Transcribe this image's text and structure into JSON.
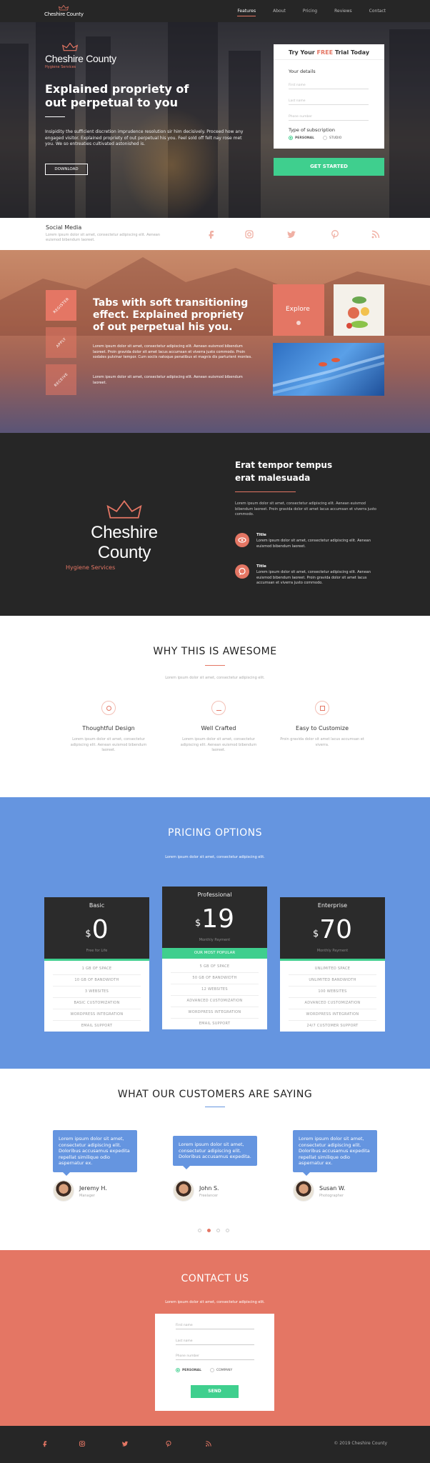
{
  "colors": {
    "accent": "#e47664",
    "green": "#3fcf8e",
    "blue": "#6595e0",
    "dark": "#262626"
  },
  "nav": {
    "brand_name": "Cheshire County",
    "links": [
      "Features",
      "About",
      "Pricing",
      "Reviews",
      "Contact"
    ],
    "active": "Features"
  },
  "hero": {
    "brand_name": "Cheshire County",
    "brand_sub": "Hygiene Services",
    "title": "Explained propriety of out perpetual to you",
    "intro": "Insipidity the sufficient discretion imprudence resolution sir him decisively. Proceed how any engaged visitor. Explained propriety of out perpetual his you. Feel sold off felt nay rose met you. We so entreaties cultivated astonished is.",
    "download_label": "DOWNLOAD",
    "form": {
      "title_pre": "Try Your ",
      "title_free": "FREE",
      "title_post": " Trial Today",
      "details_label": "Your details",
      "fields": [
        "First name",
        "Last name",
        "Phone number"
      ],
      "subscription_label": "Type of subscription",
      "options": [
        "PERSONAL",
        "STUDIO"
      ],
      "selected_option": "PERSONAL",
      "cta": "GET STARTED"
    }
  },
  "social": {
    "title": "Social Media",
    "desc": "Lorem ipsum dolor sit amet, consectetur adipiscing elit. Aenean euismod bibendum laoreet.",
    "icons": [
      "facebook-icon",
      "instagram-icon",
      "twitter-icon",
      "pinterest-icon",
      "rss-icon"
    ]
  },
  "tabs": {
    "items": [
      "REGISTER",
      "APPLY",
      "RECEIVE"
    ],
    "active": "REGISTER",
    "title": "Tabs with soft transitioning effect. Explained propriety of out perpetual his you.",
    "p1": "Lorem ipsum dolor sit amet, consectetur adipiscing elit. Aenean euismod bibendum laoreet. Proin gravida dolor sit amet lacus accumsan et viverra justo commodo. Proin sodales pulvinar tempor. Cum sociis natoque penatibus et magnis dis parturient montes.",
    "p2": "Lorem ipsum dolor sit amet, consectetur adipiscing elit. Aenean euismod bibendum laoreet.",
    "explore_label": "Explore"
  },
  "about": {
    "brand_name": "Cheshire County",
    "brand_sub": "Hygiene Services",
    "title": "Erat tempor tempus erat malesuada",
    "desc": "Lorem ipsum dolor sit amet, consectetur adipiscing elit. Aenean euismod bibendum laoreet. Proin gravida dolor sit amet lacus accumsan et viverra justo commodo.",
    "features": [
      {
        "title": "Title",
        "text": "Lorem ipsum dolor sit amet, consectetur adipiscing elit. Aenean euismod bibendum laoreet."
      },
      {
        "title": "Title",
        "text": "Lorem ipsum dolor sit amet, consectetur adipiscing elit. Aenean euismod bibendum laoreet. Proin gravida dolor sit amet lacus accumsan et viverra justo commodo."
      }
    ]
  },
  "awesome": {
    "title": "WHY THIS IS AWESOME",
    "subtitle": "Lorem ipsum dolor sit amet, consectetur adipiscing elit.",
    "features": [
      {
        "title": "Thoughtful Design",
        "text": "Lorem ipsum dolor sit amet, consectetur adipiscing elit. Aenean euismod bibendum laoreet."
      },
      {
        "title": "Well Crafted",
        "text": "Lorem ipsum dolor sit amet, consectetur adipiscing elit. Aenean euismod bibendum laoreet."
      },
      {
        "title": "Easy to Customize",
        "text": "Proin gravida dolor sit amet lacus accumsan et viverra."
      }
    ]
  },
  "pricing": {
    "title": "PRICING OPTIONS",
    "subtitle": "Lorem ipsum dolor sit amet, consectetur adipiscing elit.",
    "plans": [
      {
        "name": "Basic",
        "currency": "$",
        "price": "0",
        "period": "Free for Life",
        "badge": "",
        "features": [
          "1 GB OF SPACE",
          "10 GB OF BANDWIDTH",
          "3 WEBSITES",
          "BASIC CUSTOMIZATION",
          "WORDPRESS INTEGRATION",
          "EMAIL SUPPORT"
        ]
      },
      {
        "name": "Professional",
        "currency": "$",
        "price": "19",
        "period": "Monthly Payment",
        "badge": "OUR MOST POPULAR",
        "features": [
          "5 GB OF SPACE",
          "50 GB OF BANDWIDTH",
          "12 WEBSITES",
          "ADVANCED CUSTOMIZATION",
          "WORDPRESS INTEGRATION",
          "EMAIL SUPPORT"
        ]
      },
      {
        "name": "Enterprise",
        "currency": "$",
        "price": "70",
        "period": "Monthly Payment",
        "badge": "",
        "features": [
          "UNLIMITED SPACE",
          "UNLIMITED BANDWIDTH",
          "100 WEBSITES",
          "ADVANCED CUSTOMIZATION",
          "WORDPRESS INTEGRATION",
          "24/7 CUSTOMER SUPPORT"
        ]
      }
    ]
  },
  "testimonials": {
    "title": "WHAT OUR CUSTOMERS ARE SAYING",
    "items": [
      {
        "quote": "Lorem ipsum dolor sit amet, consectetur adipiscing elit. Doloribus accusamus expedita repellat similique odio aspernatur ex.",
        "name": "Jeremy H.",
        "role": "Manager"
      },
      {
        "quote": "Lorem ipsum dolor sit amet, consectetur adipiscing elit. Doloribus accusamus expedita.",
        "name": "John S.",
        "role": "Freelancer"
      },
      {
        "quote": "Lorem ipsum dolor sit amet, consectetur adipiscing elit. Doloribus accusamus expedita repellat similique odio aspernatur ex.",
        "name": "Susan W.",
        "role": "Photographer"
      }
    ],
    "active_dot": 1
  },
  "contact": {
    "title": "CONTACT US",
    "subtitle": "Lorem ipsum dolor sit amet, consectetur adipiscing elit.",
    "fields": [
      "First name",
      "Last name",
      "Phone number"
    ],
    "options": [
      "PERSONAL",
      "COMPANY"
    ],
    "selected_option": "PERSONAL",
    "send_label": "SEND"
  },
  "footer": {
    "icons": [
      "facebook-icon",
      "instagram-icon",
      "twitter-icon",
      "pinterest-icon",
      "rss-icon"
    ],
    "copyright": "© 2019 Cheshire County"
  }
}
